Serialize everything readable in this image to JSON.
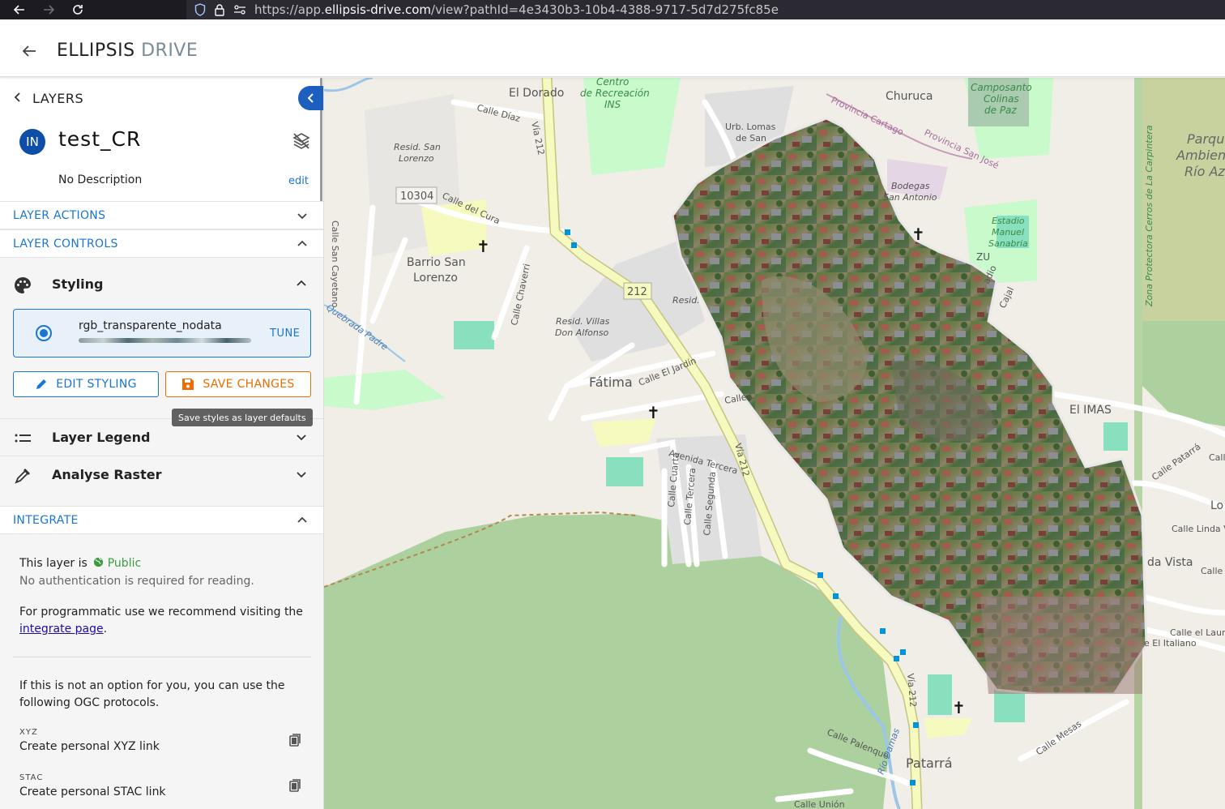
{
  "browser": {
    "url_prefix": "https://app.",
    "url_domain": "ellipsis-drive.com",
    "url_suffix": "/view?pathId=4e3430b3-10b4-4388-9717-5d7d275fc85e"
  },
  "header": {
    "logo_main": "ELLIPSIS",
    "logo_sub": "DRIVE"
  },
  "sidebar": {
    "layers_label": "LAYERS",
    "layer": {
      "avatar": "IN",
      "name": "test_CR",
      "description": "No Description",
      "edit_label": "edit"
    },
    "sections": {
      "layer_actions": "LAYER ACTIONS",
      "layer_controls": "LAYER CONTROLS",
      "integrate": "INTEGRATE"
    },
    "styling": {
      "label": "Styling",
      "style_name": "rgb_transparente_nodata",
      "tune_label": "TUNE",
      "edit_button": "EDIT STYLING",
      "save_button": "SAVE CHANGES",
      "save_tooltip": "Save styles as layer defaults"
    },
    "legend_label": "Layer Legend",
    "analyse_label": "Analyse Raster",
    "integrate": {
      "public_prefix": "This layer is",
      "public_label": "Public",
      "no_auth": "No authentication is required for reading.",
      "programmatic_prefix": "For programmatic use we recommend visiting the",
      "integrate_link": "integrate page",
      "programmatic_suffix": ".",
      "ogc_text": "If this is not an option for you, you can use the following OGC protocols.",
      "protocols": [
        {
          "label": "XYZ",
          "link": "Create personal XYZ link"
        },
        {
          "label": "STAC",
          "link": "Create personal STAC link"
        }
      ]
    }
  },
  "map": {
    "labels": {
      "el_dorado": "El Dorado",
      "centro_1": "Centro",
      "centro_2": "de Recreación",
      "centro_3": "INS",
      "churuca": "Churuca",
      "camposanto_1": "Camposanto",
      "camposanto_2": "Colinas",
      "camposanto_3": "de Paz",
      "parque_1": "Parqu",
      "parque_2": "Ambien",
      "parque_3": "Río Az",
      "calle_diaz": "Calle Díaz",
      "via_212_a": "Vía 212",
      "via_212_b": "Vía 212",
      "via_212_c": "Vía 212",
      "urb_lomas_1": "Urb. Lomas",
      "urb_lomas_2": "de San",
      "prov_cartago": "Provincia Cartago",
      "prov_sanjose": "Provincia San José",
      "resid_san_1": "Resid. San",
      "resid_san_2": "Lorenzo",
      "shield_10304": "10304",
      "calle_del_cura": "Calle del Cura",
      "bodegas_1": "Bodegas",
      "bodegas_2": "San Antonio",
      "estadio_1": "Estadio",
      "estadio_2": "Manuel",
      "estadio_3": "Sanabria",
      "zona_protectora": "Zona Protectora Cerros de La Carpintera",
      "calle_san_cayetano": "Calle San Cayetano",
      "barrio_1": "Barrio San",
      "barrio_2": "Lorenzo",
      "calle_chaverri": "Calle Chaverri",
      "shield_212": "212",
      "resid": "Resid.",
      "resid_villas_1": "Resid. Villas",
      "resid_villas_2": "Don Alfonso",
      "quebrada_padre": "Quebrada Padre",
      "fatima": "Fátima",
      "calle_el_jardin": "Calle El Jardín",
      "calle_l": "Calle L",
      "el_imas": "El IMAS",
      "avenida_tercera": "Avenida Tercera",
      "calle_cuarta": "Calle Cuarta",
      "calle_tercera": "Calle Tercera",
      "calle_segunda": "Calle Segunda",
      "calle_patarra": "Calle Patarrá",
      "calle_r": "Calle",
      "lo": "Lo",
      "calle_linda_vista": "Calle Linda V",
      "linda_vista": "da Vista",
      "calle_vi": "Calle Vi",
      "calle_el_laurel": "Calle el Laure",
      "el_italiano": "e El Italiano",
      "calle_palenque": "Calle Palenque",
      "rio_damas": "Río Damas",
      "calle_mesas": "Calle Mesas",
      "patarra": "Patarrá",
      "calle_union": "Calle Unión",
      "zu": "ZU",
      "calle_aj": "Cajal",
      "radio": "adio"
    }
  },
  "colors": {
    "primary": "#1976d2",
    "accent_blue": "#1c5fbf",
    "save_orange": "#ef6c00",
    "public_green": "#3a9b3f",
    "map_bg": "#f1eee8",
    "forest_green": "#add19e",
    "road_yellow": "#f7fabf"
  }
}
